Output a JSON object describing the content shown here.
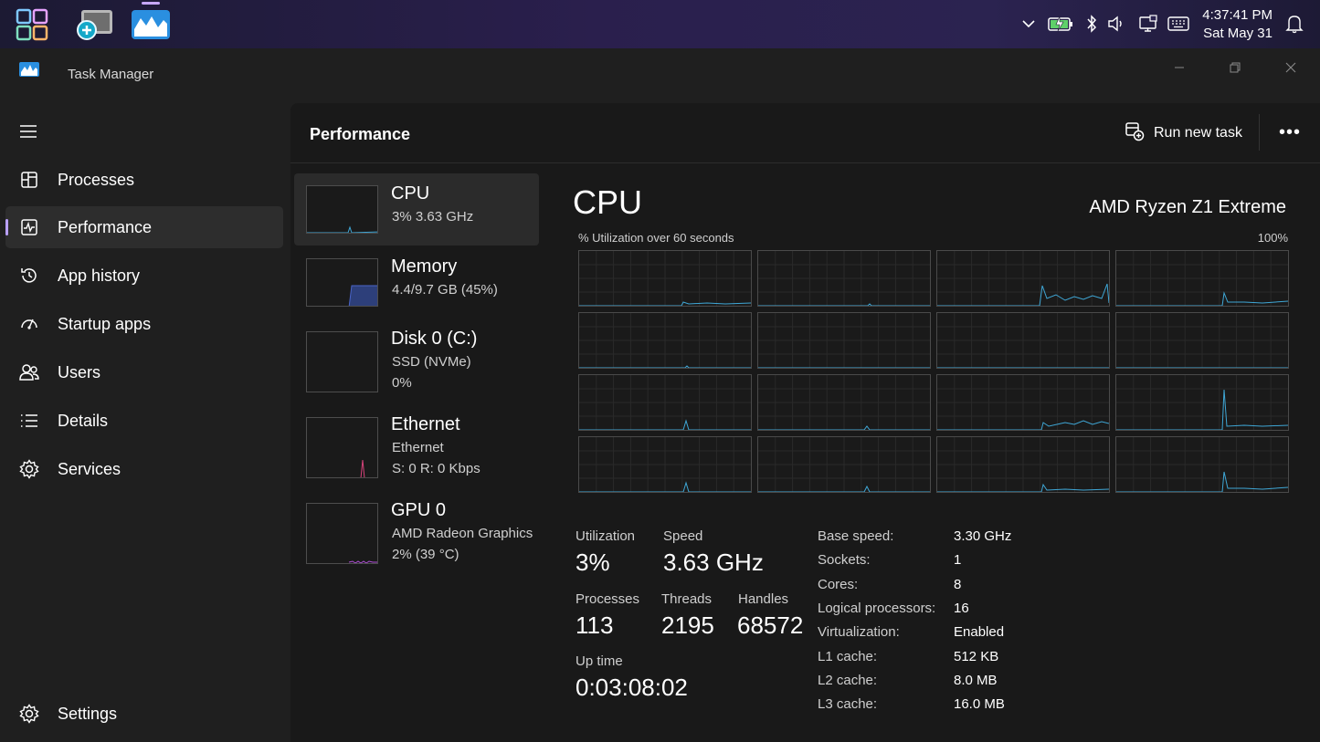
{
  "taskbar": {
    "clock_time": "4:37:41 PM",
    "clock_date": "Sat May 31",
    "icons": [
      "start-icon",
      "magnifier-icon",
      "task-manager-icon",
      "chevron-up-icon",
      "battery-charging-icon",
      "bluetooth-icon",
      "volume-icon",
      "display-icon",
      "keyboard-icon",
      "notification-bell-icon"
    ]
  },
  "window": {
    "title": "Task Manager"
  },
  "sidebar": {
    "items": [
      {
        "label": "Processes",
        "icon": "processes-icon"
      },
      {
        "label": "Performance",
        "icon": "performance-icon"
      },
      {
        "label": "App history",
        "icon": "app-history-icon"
      },
      {
        "label": "Startup apps",
        "icon": "startup-apps-icon"
      },
      {
        "label": "Users",
        "icon": "users-icon"
      },
      {
        "label": "Details",
        "icon": "details-icon"
      },
      {
        "label": "Services",
        "icon": "services-icon"
      }
    ],
    "settings_label": "Settings"
  },
  "header": {
    "title": "Performance",
    "run_task_label": "Run new task",
    "more_label": "•••"
  },
  "devices": [
    {
      "name": "CPU",
      "sub1": "3%  3.63 GHz",
      "sub2": ""
    },
    {
      "name": "Memory",
      "sub1": "4.4/9.7 GB (45%)",
      "sub2": ""
    },
    {
      "name": "Disk 0 (C:)",
      "sub1": "SSD (NVMe)",
      "sub2": "0%"
    },
    {
      "name": "Ethernet",
      "sub1": "Ethernet",
      "sub2": "S: 0  R: 0 Kbps"
    },
    {
      "name": "GPU 0",
      "sub1": "AMD Radeon Graphics",
      "sub2": "2%  (39 °C)"
    }
  ],
  "cpu": {
    "title": "CPU",
    "model": "AMD Ryzen Z1 Extreme",
    "util_label": "% Utilization over 60 seconds",
    "util_max": "100%",
    "stats": {
      "utilization_label": "Utilization",
      "utilization": "3%",
      "speed_label": "Speed",
      "speed": "3.63 GHz",
      "processes_label": "Processes",
      "processes": "113",
      "threads_label": "Threads",
      "threads": "2195",
      "handles_label": "Handles",
      "handles": "68572",
      "uptime_label": "Up time",
      "uptime": "0:03:08:02"
    },
    "specs": [
      {
        "label": "Base speed:",
        "value": "3.30 GHz"
      },
      {
        "label": "Sockets:",
        "value": "1"
      },
      {
        "label": "Cores:",
        "value": "8"
      },
      {
        "label": "Logical processors:",
        "value": "16"
      },
      {
        "label": "Virtualization:",
        "value": "Enabled"
      },
      {
        "label": "L1 cache:",
        "value": "512 KB"
      },
      {
        "label": "L2 cache:",
        "value": "8.0 MB"
      },
      {
        "label": "L3 cache:",
        "value": "16.0 MB"
      }
    ]
  },
  "colors": {
    "accent": "#b9a0ff",
    "cpu_line": "#3fa7d6",
    "memory_fill": "#2d3f7a",
    "ethernet_line": "#d6437a",
    "gpu_line": "#b04fd6"
  }
}
